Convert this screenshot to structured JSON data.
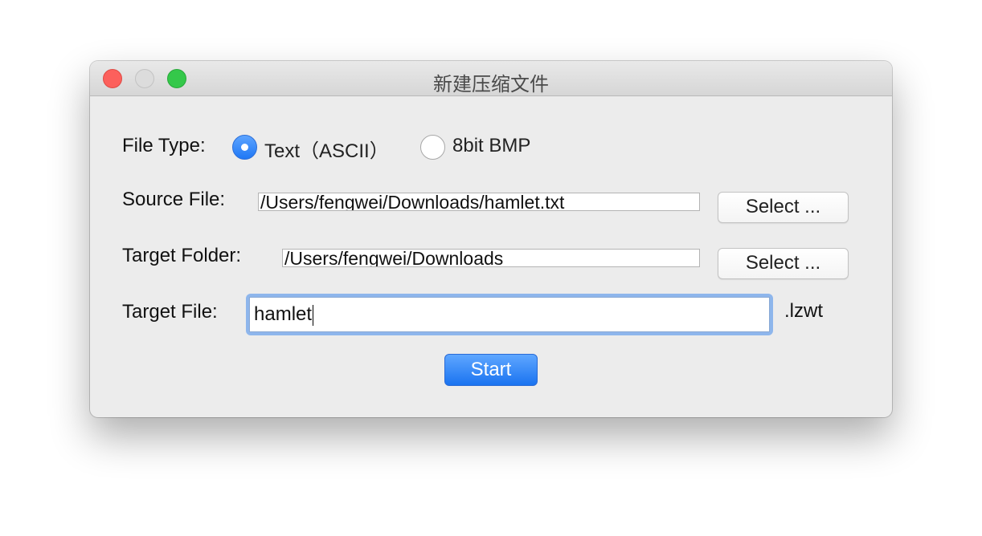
{
  "window": {
    "title": "新建压缩文件"
  },
  "form": {
    "file_type_label": "File Type:",
    "file_type_options": [
      {
        "label": "Text（ASCII）",
        "selected": true
      },
      {
        "label": "8bit BMP",
        "selected": false
      }
    ],
    "source_file_label": "Source File:",
    "source_file_value": "/Users/fengwei/Downloads/hamlet.txt",
    "source_select_label": "Select ...",
    "target_folder_label": "Target Folder:",
    "target_folder_value": "/Users/fengwei/Downloads",
    "target_select_label": "Select ...",
    "target_file_label": "Target File:",
    "target_file_value": "hamlet",
    "extension": ".lzwt",
    "start_label": "Start"
  },
  "colors": {
    "accent": "#1f78f5",
    "close": "#fc605c",
    "minimize_disabled": "#dcdcdc",
    "maximize": "#34c84a",
    "focus_ring": "#8eb6ec"
  },
  "icons": [
    "close-window-icon",
    "minimize-window-icon",
    "zoom-window-icon"
  ]
}
